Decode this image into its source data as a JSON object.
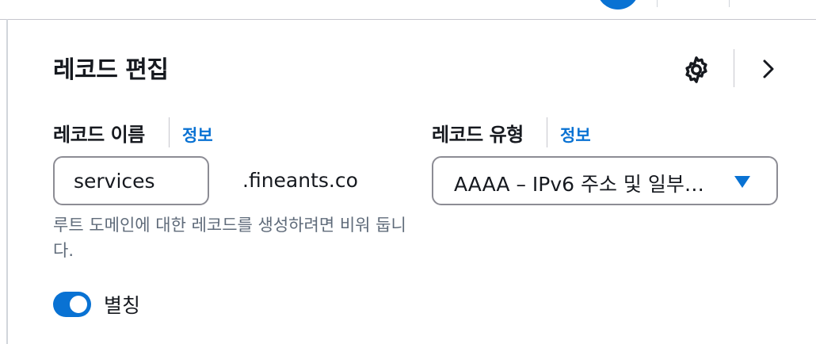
{
  "header": {
    "title": "레코드 편집",
    "icons": {
      "settings": "gear-icon",
      "collapse": "chevron-right-icon"
    }
  },
  "record_name": {
    "label": "레코드 이름",
    "info_link": "정보",
    "value": "services",
    "domain_suffix": ".fineants.co",
    "description": "루트 도메인에 대한 레코드를 생성하려면 비워 둡니다."
  },
  "record_type": {
    "label": "레코드 유형",
    "info_link": "정보",
    "selected": "AAAA – IPv6 주소 및 일부…"
  },
  "alias": {
    "label": "별칭",
    "enabled": true
  },
  "colors": {
    "accent": "#0972d3",
    "text": "#16191f",
    "muted": "#5f6b7a",
    "border": "#8c8c94"
  }
}
